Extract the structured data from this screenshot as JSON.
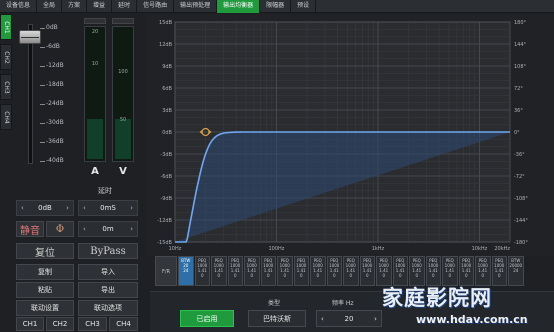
{
  "tabs": [
    "设备信息",
    "全局",
    "方案",
    "增益",
    "延时",
    "信号路由",
    "输出预处理",
    "输出均衡器",
    "限幅器",
    "预设"
  ],
  "active_tab": 7,
  "channels": [
    "CH1",
    "CH2",
    "CH3",
    "CH4"
  ],
  "fader": {
    "scale": [
      "0dB",
      "-6dB",
      "-12dB",
      "-18dB",
      "-24dB",
      "-30dB",
      "-36dB",
      "-40dB"
    ]
  },
  "meters": {
    "a_label": "A",
    "v_label": "V",
    "a_scale": [
      "20",
      "10"
    ],
    "v_scale": [
      "100",
      "50"
    ]
  },
  "delay": {
    "title": "延时",
    "gain_value": "0dB",
    "delay_ms": "0mS",
    "delay_m": "0m"
  },
  "buttons": {
    "mute": "静音",
    "phase": "Φ",
    "reset": "复位",
    "bypass": "ByPass",
    "copy": "复制",
    "import": "导入",
    "paste": "粘贴",
    "export": "导出",
    "link_set": "联动设置",
    "link_opt": "联动选项",
    "ch": [
      "CH1",
      "CH2",
      "CH3",
      "CH4"
    ]
  },
  "graph": {
    "y_left": [
      "15dB",
      "12dB",
      "9dB",
      "6dB",
      "3dB",
      "0dB",
      "-3dB",
      "-6dB",
      "-9dB",
      "-12dB",
      "-15dB"
    ],
    "y_right": [
      "180°",
      "144°",
      "108°",
      "72°",
      "36°",
      "0°",
      "-36°",
      "-72°",
      "-108°",
      "-144°",
      "-180°"
    ],
    "x_labels": [
      "10Hz",
      "100Hz",
      "1kHz",
      "10kHz",
      "20kHz"
    ],
    "curve_color": "#6fa8f0"
  },
  "bands": [
    {
      "label": "F/R"
    },
    {
      "l1": "BTW",
      "l2": "20",
      "l3": "24"
    },
    {
      "l1": "PEQ",
      "l2": "1000",
      "l3": "1.41",
      "l4": "0"
    },
    {
      "l1": "PEQ",
      "l2": "1000",
      "l3": "1.41",
      "l4": "0"
    },
    {
      "l1": "PEQ",
      "l2": "1000",
      "l3": "1.41",
      "l4": "0"
    },
    {
      "l1": "PEQ",
      "l2": "1000",
      "l3": "1.41",
      "l4": "0"
    },
    {
      "l1": "PEQ",
      "l2": "1000",
      "l3": "1.41",
      "l4": "0"
    },
    {
      "l1": "PEQ",
      "l2": "1000",
      "l3": "1.41",
      "l4": "0"
    },
    {
      "l1": "PEQ",
      "l2": "1000",
      "l3": "1.41",
      "l4": "0"
    },
    {
      "l1": "PEQ",
      "l2": "1000",
      "l3": "1.41",
      "l4": "0"
    },
    {
      "l1": "PEQ",
      "l2": "1000",
      "l3": "1.41",
      "l4": "0"
    },
    {
      "l1": "PEQ",
      "l2": "1000",
      "l3": "1.41",
      "l4": "0"
    },
    {
      "l1": "PEQ",
      "l2": "1000",
      "l3": "1.41",
      "l4": "0"
    },
    {
      "l1": "PEQ",
      "l2": "1000",
      "l3": "1.41",
      "l4": "0"
    },
    {
      "l1": "PEQ",
      "l2": "1000",
      "l3": "1.41",
      "l4": "0"
    },
    {
      "l1": "PEQ",
      "l2": "1000",
      "l3": "1.41",
      "l4": "0"
    },
    {
      "l1": "PEQ",
      "l2": "1000",
      "l3": "1.41",
      "l4": "0"
    },
    {
      "l1": "PEQ",
      "l2": "1000",
      "l3": "1.41",
      "l4": "0"
    },
    {
      "l1": "PEQ",
      "l2": "1000",
      "l3": "1.41",
      "l4": "0"
    },
    {
      "l1": "PEQ",
      "l2": "1000",
      "l3": "1.41",
      "l4": "0"
    },
    {
      "l1": "PEQ",
      "l2": "1000",
      "l3": "1.41",
      "l4": "0"
    },
    {
      "l1": "BTW",
      "l2": "20000",
      "l3": "24"
    }
  ],
  "bottom": {
    "on_label": "已启用",
    "type_label": "类型",
    "type_value": "巴特沃斯",
    "freq_label": "频率 Hz",
    "freq_value": "20"
  },
  "watermark": {
    "text": "家庭影院网",
    "url": "www.hdav.com.cn"
  }
}
